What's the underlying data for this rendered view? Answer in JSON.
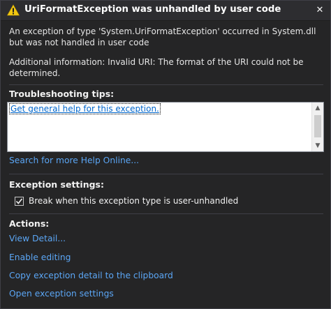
{
  "dialog": {
    "title": "UriFormatException was unhandled by user code",
    "close_label": "✕",
    "description": "An exception of type 'System.UriFormatException' occurred in System.dll but was not handled in user code",
    "additional_info": "Additional information: Invalid URI: The format of the URI could not be determined."
  },
  "troubleshooting": {
    "heading": "Troubleshooting tips:",
    "tips": [
      "Get general help for this exception."
    ],
    "search_online_label": "Search for more Help Online..."
  },
  "exception_settings": {
    "heading": "Exception settings:",
    "break_label": "Break when this exception type is user-unhandled",
    "break_checked": true
  },
  "actions": {
    "heading": "Actions:",
    "items": [
      "View Detail...",
      "Enable editing",
      "Copy exception detail to the clipboard",
      "Open exception settings"
    ]
  },
  "icons": {
    "title_icon": "warning-icon",
    "close_icon": "close-icon",
    "checkbox_icon": "checkmark-icon"
  },
  "colors": {
    "background": "#252526",
    "link": "#5ba6f5",
    "warning": "#f2c811"
  }
}
